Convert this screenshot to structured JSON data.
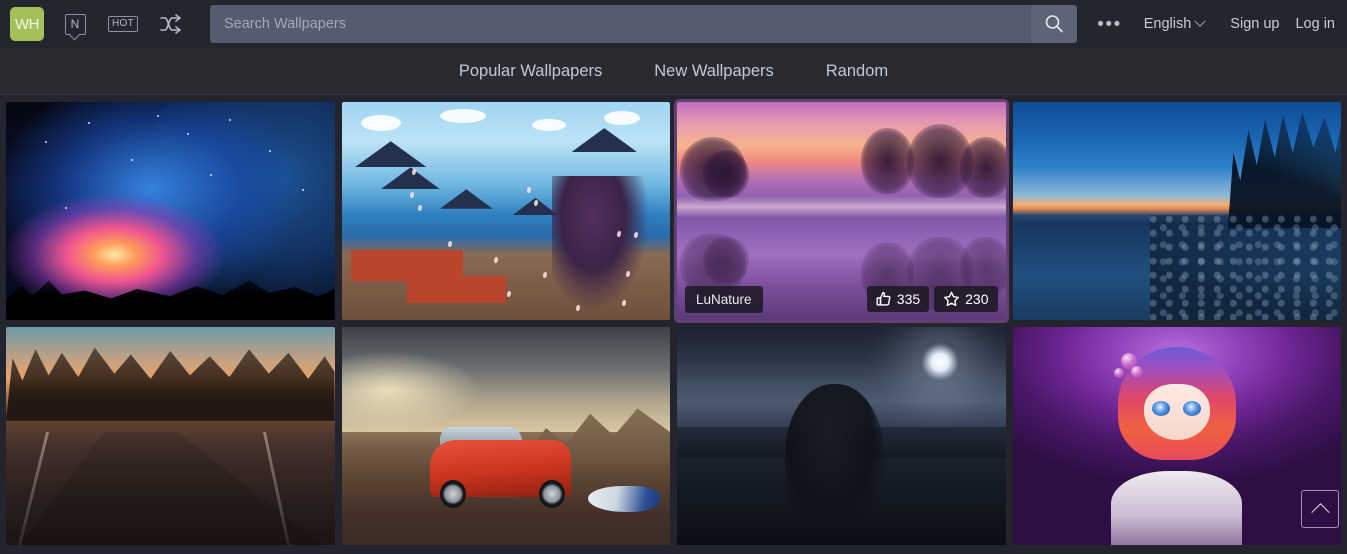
{
  "topbar": {
    "logo_text": "WH",
    "logo_color": "#a4c05a",
    "icons": [
      {
        "name": "new-tag-icon",
        "label": "N"
      },
      {
        "name": "hot-tag-icon",
        "label": "HOT"
      },
      {
        "name": "shuffle-icon",
        "label": "shuffle"
      }
    ],
    "search": {
      "placeholder": "Search Wallpapers",
      "value": "",
      "button_icon": "search-icon"
    },
    "more_menu": "•••",
    "language": "English",
    "sign_up": "Sign up",
    "log_in": "Log in"
  },
  "nav": {
    "items": [
      {
        "label": "Popular Wallpapers"
      },
      {
        "label": "New Wallpapers"
      },
      {
        "label": "Random"
      }
    ]
  },
  "gallery": {
    "items": [
      {
        "name": "wallpaper-space-nebula",
        "art": "art-space",
        "description": "Colorful space nebula with planet and rocky silhouette",
        "hovered": false
      },
      {
        "name": "wallpaper-anime-village",
        "art": "art-village",
        "description": "Anime illustration of a Japanese seaside village festival",
        "hovered": false
      },
      {
        "name": "wallpaper-purple-lake",
        "art": "art-lake",
        "description": "Purple and pink sunset over a misty lake with reflections",
        "hovered": true,
        "uploader": "LuNature",
        "likes": "335",
        "favorites": "230"
      },
      {
        "name": "wallpaper-blue-hour-shore",
        "art": "art-blue",
        "description": "Blue hour sunset over a pebble shoreline with pine trees",
        "hovered": false
      },
      {
        "name": "wallpaper-railway-forest",
        "art": "art-rail",
        "description": "Railway tracks curving through an autumn forest at sunset",
        "hovered": false
      },
      {
        "name": "wallpaper-red-car-mountains",
        "art": "art-car",
        "description": "Red estate car parked in a mountain valley under storm clouds",
        "hovered": false
      },
      {
        "name": "wallpaper-catwoman-rooftop",
        "art": "art-night",
        "description": "Woman in black leather crouching on a moonlit rooftop",
        "hovered": false
      },
      {
        "name": "wallpaper-anime-girl-red-hair",
        "art": "art-anime",
        "description": "Anime girl with red and purple gradient hair on magenta background",
        "hovered": false
      }
    ]
  },
  "scroll_to_top": {
    "icon": "chevron-up-icon",
    "label": "Back to top"
  }
}
